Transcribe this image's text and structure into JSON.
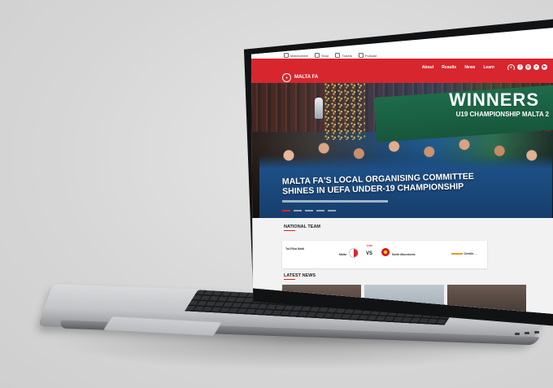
{
  "site": {
    "topbar": [
      "Matchcentre",
      "Shop",
      "Tickets",
      "Podcast"
    ],
    "nav": [
      "About",
      "Results",
      "News",
      "Learn"
    ],
    "icons": [
      "search-icon",
      "facebook-icon",
      "instagram-icon",
      "x-icon",
      "youtube-icon"
    ],
    "logo": "MALTA FA",
    "brand_color": "#d7262e"
  },
  "hero": {
    "title": "MALTA FA'S LOCAL ORGANISING COMMITTEE SHINES IN UEFA UNDER-19 CHAMPIONSHIP",
    "banner_title": "WINNERS",
    "banner_sub": "U19 CHAMPIONSHIP MALTA 2"
  },
  "national_team": {
    "title": "NATIONAL TEAM",
    "competition": "Tal-Flika Malti",
    "home": "Malta",
    "status": "Live",
    "vs": "VS",
    "away": "North Macedonia",
    "details": "Details →"
  },
  "latest_news": {
    "title": "LATEST NEWS"
  }
}
